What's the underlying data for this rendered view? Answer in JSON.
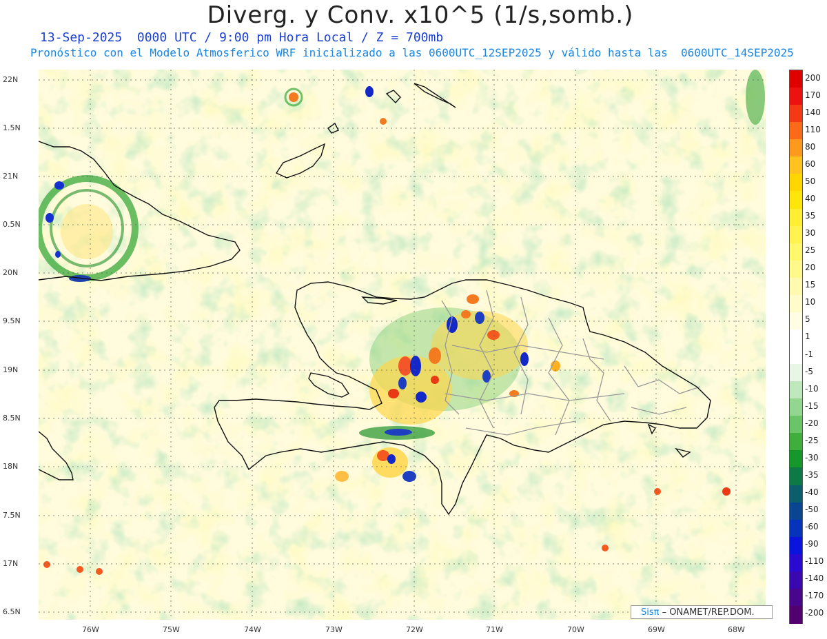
{
  "header": {
    "title": "Diverg. y Conv. x10^5 (1/s,somb.)",
    "subtitle_1": "13-Sep-2025  0000 UTC / 9:00 pm Hora Local / Z = 700mb",
    "subtitle_2": "Pronóstico con el Modelo Atmosferico WRF inicializado a las 0600UTC_12SEP2025 y válido hasta las  0600UTC_14SEP2025"
  },
  "axes": {
    "lat_labels": [
      "22N",
      "1.5N",
      "21N",
      "0.5N",
      "20N",
      "9.5N",
      "19N",
      "8.5N",
      "18N",
      "7.5N",
      "17N",
      "6.5N"
    ],
    "lon_labels": [
      "76W",
      "75W",
      "74W",
      "73W",
      "72W",
      "71W",
      "70W",
      "69W",
      "68W"
    ]
  },
  "colorbar": {
    "labels": [
      "200",
      "170",
      "140",
      "110",
      "80",
      "60",
      "50",
      "40",
      "35",
      "30",
      "25",
      "20",
      "15",
      "10",
      "5",
      "1",
      "-1",
      "-5",
      "-10",
      "-15",
      "-20",
      "-25",
      "-30",
      "-35",
      "-40",
      "-50",
      "-60",
      "-90",
      "-110",
      "-140",
      "-170",
      "-200"
    ],
    "colors": [
      "#e00000",
      "#ec1212",
      "#f43a14",
      "#fa6a18",
      "#fd9a1e",
      "#ffc21e",
      "#ffd600",
      "#ffe60a",
      "#ffee32",
      "#fff34f",
      "#fff76c",
      "#fff98c",
      "#fffab0",
      "#fffccc",
      "#fffde4",
      "#ffffff",
      "#ffffff",
      "#e8f6e6",
      "#bfe8bc",
      "#93d690",
      "#6bc468",
      "#3fae3c",
      "#15972a",
      "#0d7a46",
      "#0b5e6c",
      "#0a4592",
      "#0633bb",
      "#0a14dc",
      "#2a0ad0",
      "#3a08b0",
      "#48068c",
      "#520070"
    ]
  },
  "credit": {
    "sis": "Sis",
    "pi": "π",
    "rest": " – ONAMET/REP.DOM."
  }
}
